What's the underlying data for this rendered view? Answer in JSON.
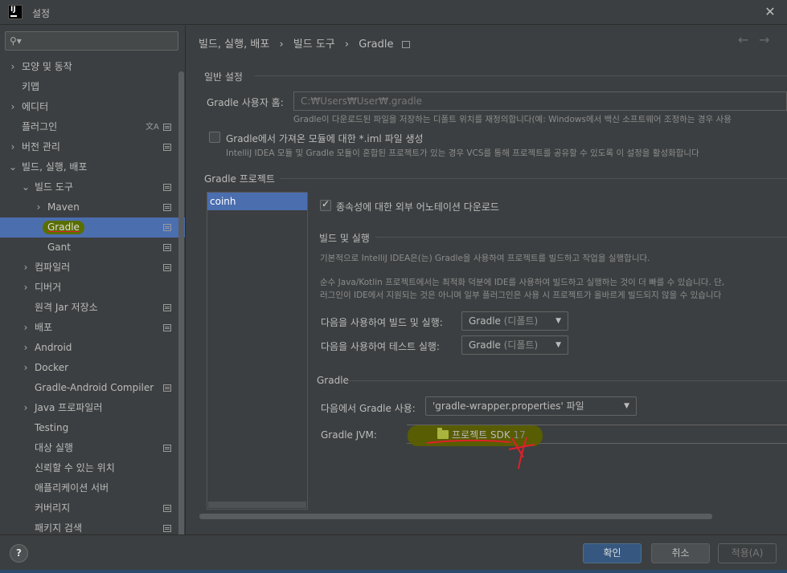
{
  "window": {
    "title": "설정",
    "app_icon_text": "IJ"
  },
  "sidebar": {
    "search_placeholder": "",
    "items": [
      {
        "label": "모양 및 동작",
        "level": 0,
        "arrow": "›",
        "page_icon": false
      },
      {
        "label": "키맵",
        "level": 0,
        "arrow": "",
        "page_icon": false
      },
      {
        "label": "에디터",
        "level": 0,
        "arrow": "›",
        "page_icon": false
      },
      {
        "label": "플러그인",
        "level": 0,
        "arrow": "",
        "page_icon": true,
        "translate_icon": true
      },
      {
        "label": "버전 관리",
        "level": 0,
        "arrow": "›",
        "page_icon": true
      },
      {
        "label": "빌드, 실행, 배포",
        "level": 0,
        "arrow": "⌄",
        "page_icon": false
      },
      {
        "label": "빌드 도구",
        "level": 1,
        "arrow": "⌄",
        "page_icon": true
      },
      {
        "label": "Maven",
        "level": 2,
        "arrow": "›",
        "page_icon": true
      },
      {
        "label": "Gradle",
        "level": 2,
        "arrow": "",
        "page_icon": true,
        "selected": true
      },
      {
        "label": "Gant",
        "level": 2,
        "arrow": "",
        "page_icon": true
      },
      {
        "label": "컴파일러",
        "level": 1,
        "arrow": "›",
        "page_icon": true
      },
      {
        "label": "디버거",
        "level": 1,
        "arrow": "›",
        "page_icon": false
      },
      {
        "label": "원격 Jar 저장소",
        "level": 1,
        "arrow": "",
        "page_icon": true
      },
      {
        "label": "배포",
        "level": 1,
        "arrow": "›",
        "page_icon": true
      },
      {
        "label": "Android",
        "level": 1,
        "arrow": "›",
        "page_icon": false
      },
      {
        "label": "Docker",
        "level": 1,
        "arrow": "›",
        "page_icon": false
      },
      {
        "label": "Gradle-Android Compiler",
        "level": 1,
        "arrow": "",
        "page_icon": true
      },
      {
        "label": "Java 프로파일러",
        "level": 1,
        "arrow": "›",
        "page_icon": false
      },
      {
        "label": "Testing",
        "level": 1,
        "arrow": "",
        "page_icon": false
      },
      {
        "label": "대상 실행",
        "level": 1,
        "arrow": "",
        "page_icon": true
      },
      {
        "label": "신뢰할 수 있는 위치",
        "level": 1,
        "arrow": "",
        "page_icon": false
      },
      {
        "label": "애플리케이션 서버",
        "level": 1,
        "arrow": "",
        "page_icon": false
      },
      {
        "label": "커버리지",
        "level": 1,
        "arrow": "",
        "page_icon": true
      },
      {
        "label": "패키지 검색",
        "level": 1,
        "arrow": "",
        "page_icon": true
      }
    ]
  },
  "breadcrumb": {
    "part1": "빌드, 실행, 배포",
    "part2": "빌드 도구",
    "part3": "Gradle",
    "sep": "›"
  },
  "general": {
    "section_title": "일반 설정",
    "home_label": "Gradle 사용자 홈:",
    "home_value": "C:₩Users₩User₩.gradle",
    "home_hint": "Gradle이 다운로드된 파일을 저장하는 디폴트 위치를 재정의합니다(예: Windows에서 백신 소프트웨어 조정하는 경우 사용",
    "generate_iml_label": "Gradle에서 가져온 모듈에 대한 *.iml 파일 생성",
    "generate_iml_hint": "IntelliJ IDEA 모듈 및 Gradle 모듈이 혼합된 프로젝트가 있는 경우 VCS를 통해 프로젝트를 공유할 수 있도록 이 설정을 활성화합니다"
  },
  "projects": {
    "section_title": "Gradle 프로젝트",
    "list": [
      "coinh"
    ],
    "download_annotations_label": "종속성에 대한 외부 어노테이션 다운로드",
    "build_section_title": "빌드 및 실행",
    "build_hint1": "기본적으로 IntelliJ IDEA은(는) Gradle을 사용하여 프로젝트를 빌드하고 작업을 실행합니다.",
    "build_hint2": "순수 Java/Kotlin 프로젝트에서는 최적화 덕분에 IDE를 사용하여 빌드하고 실행하는 것이 더 빠를 수 있습니다. 단,",
    "build_hint3": "러그인이 IDE에서 지원되는 것은 아니며 일부 플러그인은 사용 시 프로젝트가 올바르게 빌드되지 않을 수 있습니다",
    "build_run_label": "다음을 사용하여 빌드 및 실행:",
    "build_run_value": "Gradle",
    "build_run_suffix": "(디폴트)",
    "test_run_label": "다음을 사용하여 테스트 실행:",
    "test_run_value": "Gradle",
    "test_run_suffix": "(디폴트)",
    "gradle_section_title": "Gradle",
    "use_gradle_from_label": "다음에서 Gradle 사용:",
    "use_gradle_from_value": "'gradle-wrapper.properties' 파일",
    "jvm_label": "Gradle JVM:",
    "jvm_value": "프로젝트 SDK",
    "jvm_version": "17"
  },
  "footer": {
    "help": "?",
    "ok": "확인",
    "cancel": "취소",
    "apply": "적용(A)"
  },
  "colors": {
    "selection": "#4b6eaf",
    "ok_button": "#365880",
    "highlight_mark": "#5a5e00",
    "red_scribble": "#e0202a"
  }
}
